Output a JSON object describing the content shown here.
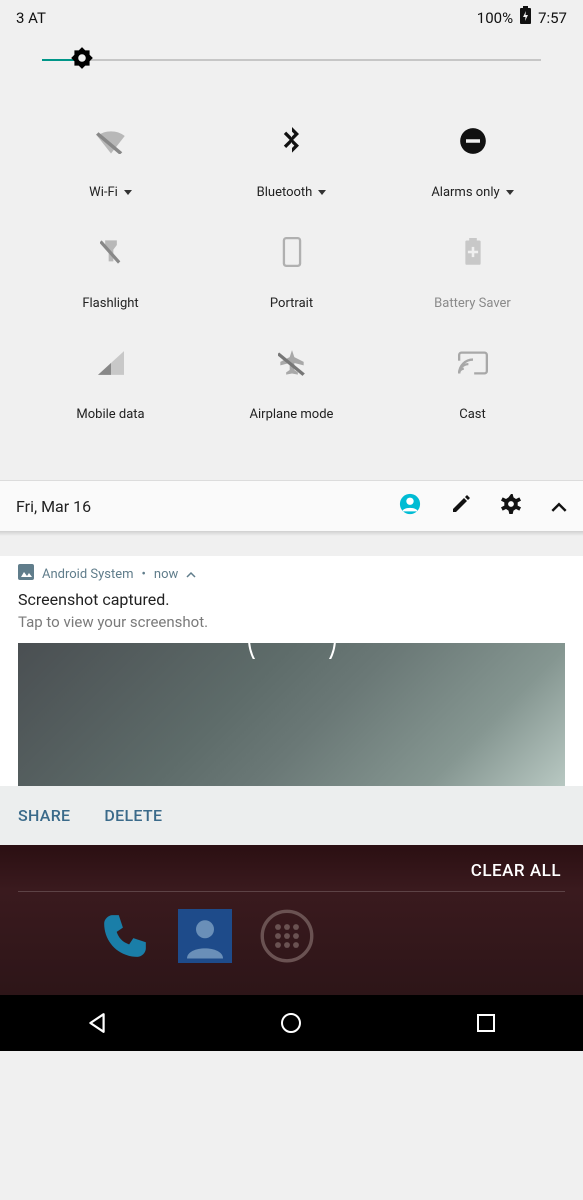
{
  "status": {
    "carrier": "3 AT",
    "battery": "100%",
    "time": "7:57"
  },
  "brightness": {
    "pct": 8
  },
  "tiles": [
    {
      "label": "Wi-Fi",
      "icon": "wifi-off",
      "dropdown": true,
      "enabled": true
    },
    {
      "label": "Bluetooth",
      "icon": "bluetooth",
      "dropdown": true,
      "enabled": true
    },
    {
      "label": "Alarms only",
      "icon": "dnd",
      "dropdown": true,
      "enabled": true,
      "active": true
    },
    {
      "label": "Flashlight",
      "icon": "flashlight-off",
      "dropdown": false,
      "enabled": true
    },
    {
      "label": "Portrait",
      "icon": "portrait",
      "dropdown": false,
      "enabled": true
    },
    {
      "label": "Battery Saver",
      "icon": "battery-saver",
      "dropdown": false,
      "enabled": false
    },
    {
      "label": "Mobile data",
      "icon": "signal",
      "dropdown": false,
      "enabled": true
    },
    {
      "label": "Airplane mode",
      "icon": "airplane-off",
      "dropdown": false,
      "enabled": true
    },
    {
      "label": "Cast",
      "icon": "cast",
      "dropdown": false,
      "enabled": true
    }
  ],
  "footer": {
    "date": "Fri, Mar 16"
  },
  "notification": {
    "app": "Android System",
    "sep": "•",
    "when": "now",
    "title": "Screenshot captured.",
    "subtitle": "Tap to view your screenshot.",
    "actions": {
      "share": "SHARE",
      "delete": "DELETE"
    }
  },
  "clear_all": "CLEAR ALL"
}
